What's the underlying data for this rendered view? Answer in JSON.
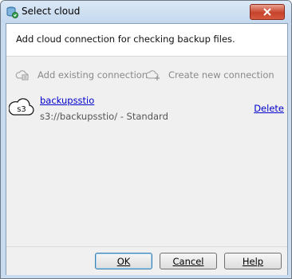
{
  "window": {
    "title": "Select cloud"
  },
  "header": {
    "text": "Add cloud connection for checking backup files."
  },
  "toolbar": {
    "add_existing": "Add existing connection",
    "create_new": "Create new connection"
  },
  "connection": {
    "icon_label": "s3",
    "name": "backupsstio",
    "path": "s3://backupsstio/ - Standard",
    "delete_label": "Delete"
  },
  "buttons": {
    "ok": "OK",
    "cancel": "Cancel",
    "help": "Help"
  }
}
